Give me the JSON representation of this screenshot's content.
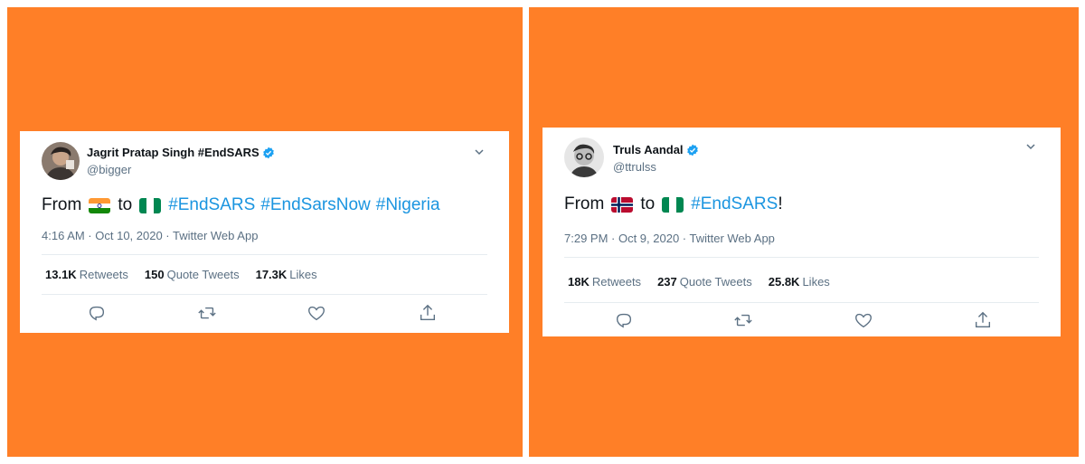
{
  "background_color": "#FF7F27",
  "tweets": [
    {
      "author_name": "Jagrit Pratap Singh #EndSARS",
      "handle": "@bigger",
      "verified": true,
      "text": {
        "from": "From",
        "to": "to",
        "hashtags": [
          "#EndSARS",
          "#EndSarsNow",
          "#Nigeria"
        ],
        "flag_from": "india-flag",
        "flag_to": "nigeria-flag"
      },
      "timestamp": "4:16 AM · Oct 10, 2020 · Twitter Web App",
      "stats": {
        "retweets_count": "13.1K",
        "retweets_label": "Retweets",
        "quote_count": "150",
        "quote_label": "Quote Tweets",
        "likes_count": "17.3K",
        "likes_label": "Likes"
      },
      "actions": [
        "reply-icon",
        "retweet-icon",
        "like-icon",
        "share-icon"
      ]
    },
    {
      "author_name": "Truls Aandal",
      "handle": "@ttrulss",
      "verified": true,
      "text": {
        "from": "From",
        "to": "to",
        "hashtags": [
          "#EndSARS"
        ],
        "suffix": "!",
        "flag_from": "norway-flag",
        "flag_to": "nigeria-flag"
      },
      "timestamp": "7:29 PM · Oct 9, 2020 · Twitter Web App",
      "stats": {
        "retweets_count": "18K",
        "retweets_label": "Retweets",
        "quote_count": "237",
        "quote_label": "Quote Tweets",
        "likes_count": "25.8K",
        "likes_label": "Likes"
      },
      "actions": [
        "reply-icon",
        "retweet-icon",
        "like-icon",
        "share-icon"
      ]
    }
  ],
  "colors": {
    "hashtag": "#1b95e0",
    "verified": "#1da1f2",
    "secondary_text": "#5b7083",
    "primary_text": "#0f1419"
  }
}
